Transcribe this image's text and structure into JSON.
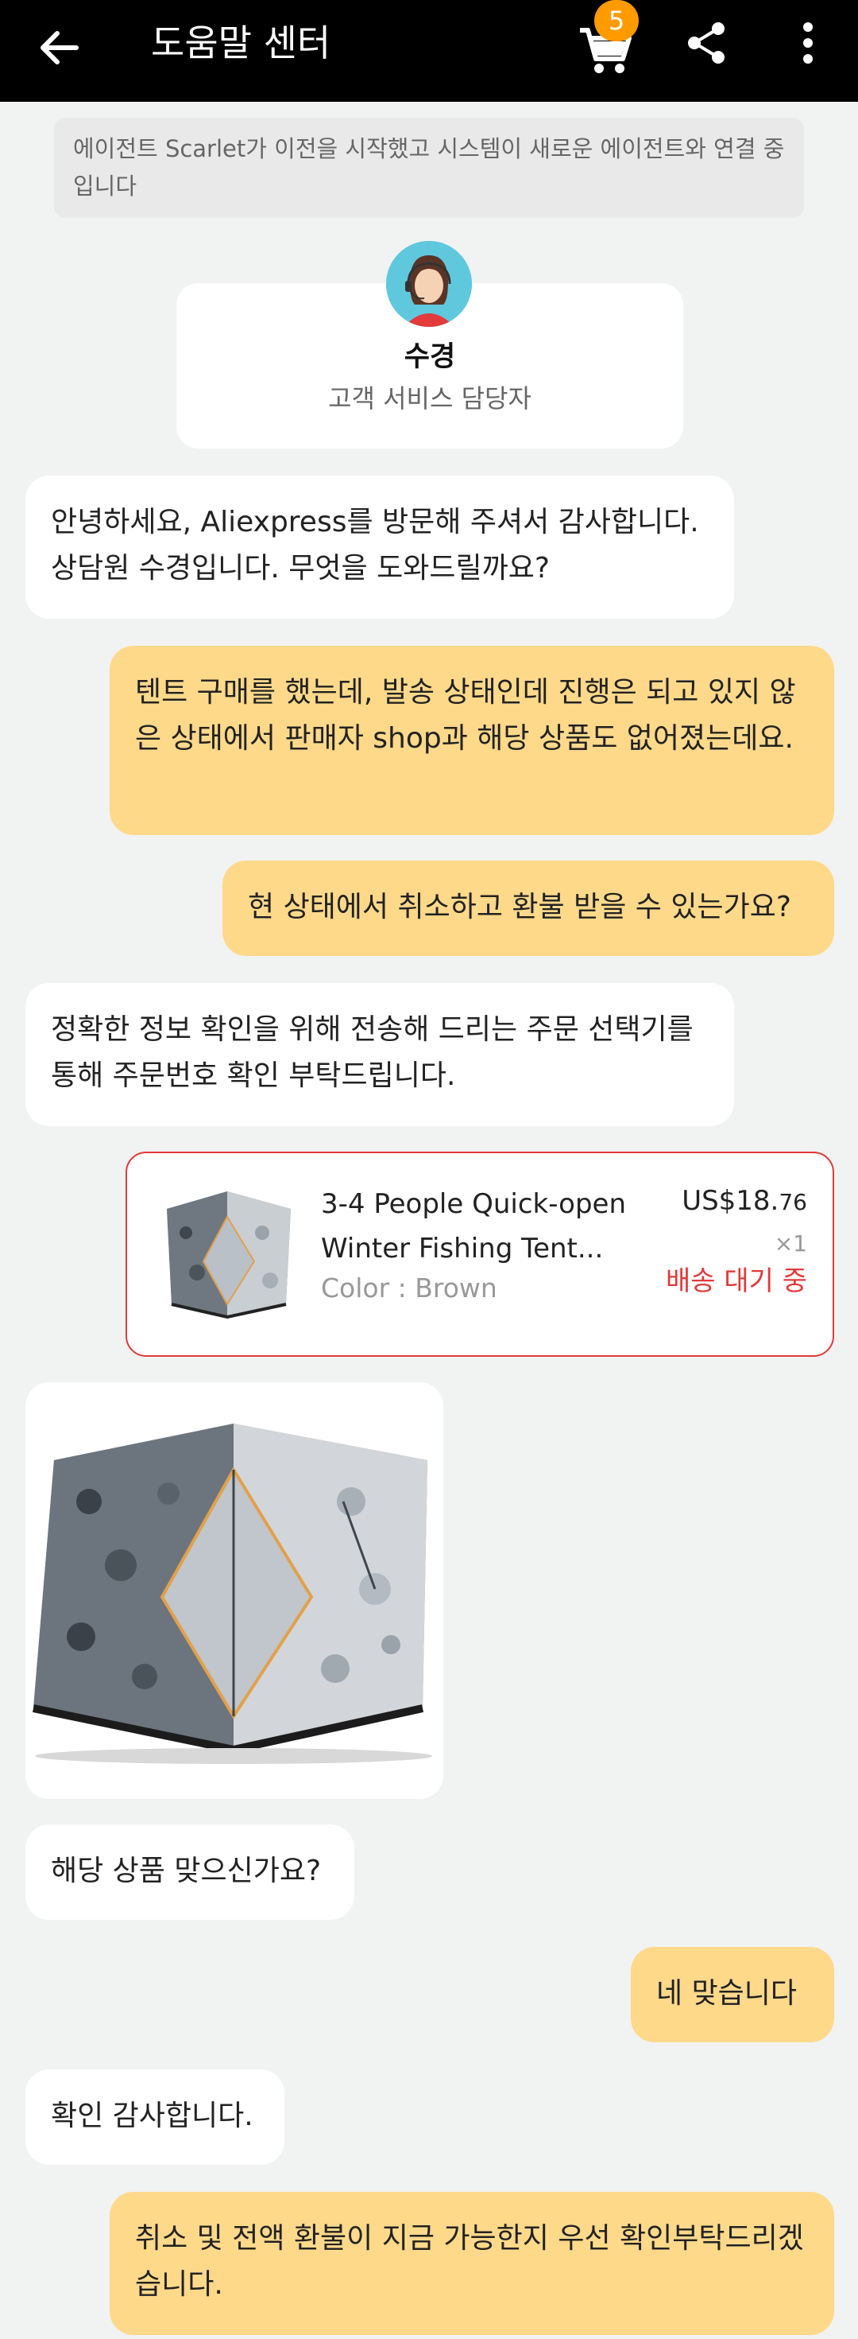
{
  "header": {
    "title": "도움말 센터",
    "cart_badge": "5",
    "background": "#000000"
  },
  "notice": {
    "text": "에이전트 Scarlet가 이전을 시작했고 시스템이 새로운 에이전트와 연결 중입니다"
  },
  "agent": {
    "name": "수경",
    "role": "고객 서비스 담당자"
  },
  "messages": [
    {
      "side": "left",
      "text": "안녕하세요, Aliexpress를 방문해 주셔서 감사합니다. 상담원 수경입니다. 무엇을 도와드릴까요?"
    },
    {
      "side": "right",
      "text": "텐트 구매를 했는데, 발송 상태인데 진행은 되고 있지 않은 상태에서 판매자 shop과 해당 상품도 없어졌는데요."
    },
    {
      "side": "right",
      "text": "현 상태에서 취소하고 환불 받을 수 있는가요?"
    },
    {
      "side": "left",
      "text": "정확한 정보 확인을 위해 전송해 드리는 주문 선택기를 통해 주문번호 확인 부탁드립니다."
    },
    {
      "side": "left",
      "text": "해당 상품 맞으신가요?"
    },
    {
      "side": "right",
      "text": "네 맞습니다"
    },
    {
      "side": "left",
      "text": "확인 감사합니다."
    },
    {
      "side": "right",
      "text": "취소 및 전액 환불이 지금 가능한지 우선 확인부탁드리겠습니다."
    }
  ],
  "order": {
    "title": "3-4 People Quick-open Winter Fishing Tent...",
    "color": "Color : Brown",
    "price_main": "US$18.",
    "price_cents": "76",
    "quantity": "×1",
    "status": "배송 대기 중",
    "status_color": "#e03a3a"
  },
  "colors": {
    "user_bubble": "#ffd98a",
    "agent_bubble": "#ffffff",
    "page_bg": "#f1f2f2",
    "badge": "#ff9b00"
  }
}
